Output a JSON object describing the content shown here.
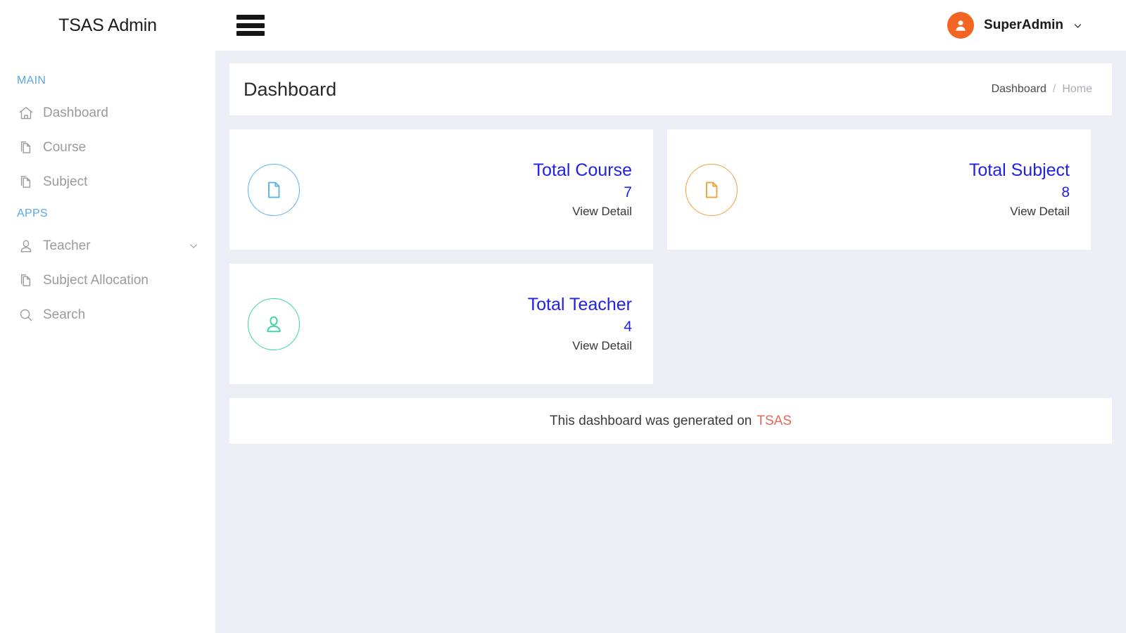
{
  "topbar": {
    "brand": "TSAS Admin",
    "menu_toggle_icon": "hamburger-icon",
    "avatar_icon": "user-avatar-icon",
    "user_name": "SuperAdmin",
    "user_caret_icon": "chevron-down-icon",
    "avatar_color": "#f26522"
  },
  "sidebar": {
    "sections": [
      {
        "label": "MAIN",
        "items": [
          {
            "label": "Dashboard",
            "icon": "home-icon",
            "has_chevron": false
          },
          {
            "label": "Course",
            "icon": "files-icon",
            "has_chevron": false
          },
          {
            "label": "Subject",
            "icon": "files-icon",
            "has_chevron": false
          }
        ]
      },
      {
        "label": "APPS",
        "items": [
          {
            "label": "Teacher",
            "icon": "user-icon",
            "has_chevron": true,
            "chevron_icon": "chevron-down-icon"
          },
          {
            "label": "Subject Allocation",
            "icon": "files-icon",
            "has_chevron": false
          },
          {
            "label": "Search",
            "icon": "search-icon",
            "has_chevron": false
          }
        ]
      }
    ],
    "section_label_color": "#5ba7e3"
  },
  "page": {
    "title": "Dashboard",
    "breadcrumb": {
      "current": "Dashboard",
      "separator": "/",
      "parent": "Home"
    }
  },
  "cards": [
    {
      "label": "Total Course",
      "value": "7",
      "link": "View Detail",
      "icon": "document-icon",
      "accent": "#5ab4e8"
    },
    {
      "label": "Total Subject",
      "value": "8",
      "link": "View Detail",
      "icon": "document-icon",
      "accent": "#eda33a"
    },
    {
      "label": "Total Teacher",
      "value": "4",
      "link": "View Detail",
      "icon": "person-icon",
      "accent": "#36d6a0"
    }
  ],
  "footer": {
    "text": "This dashboard was generated on",
    "accent_text": "TSAS",
    "accent_color": "#e2675f"
  }
}
